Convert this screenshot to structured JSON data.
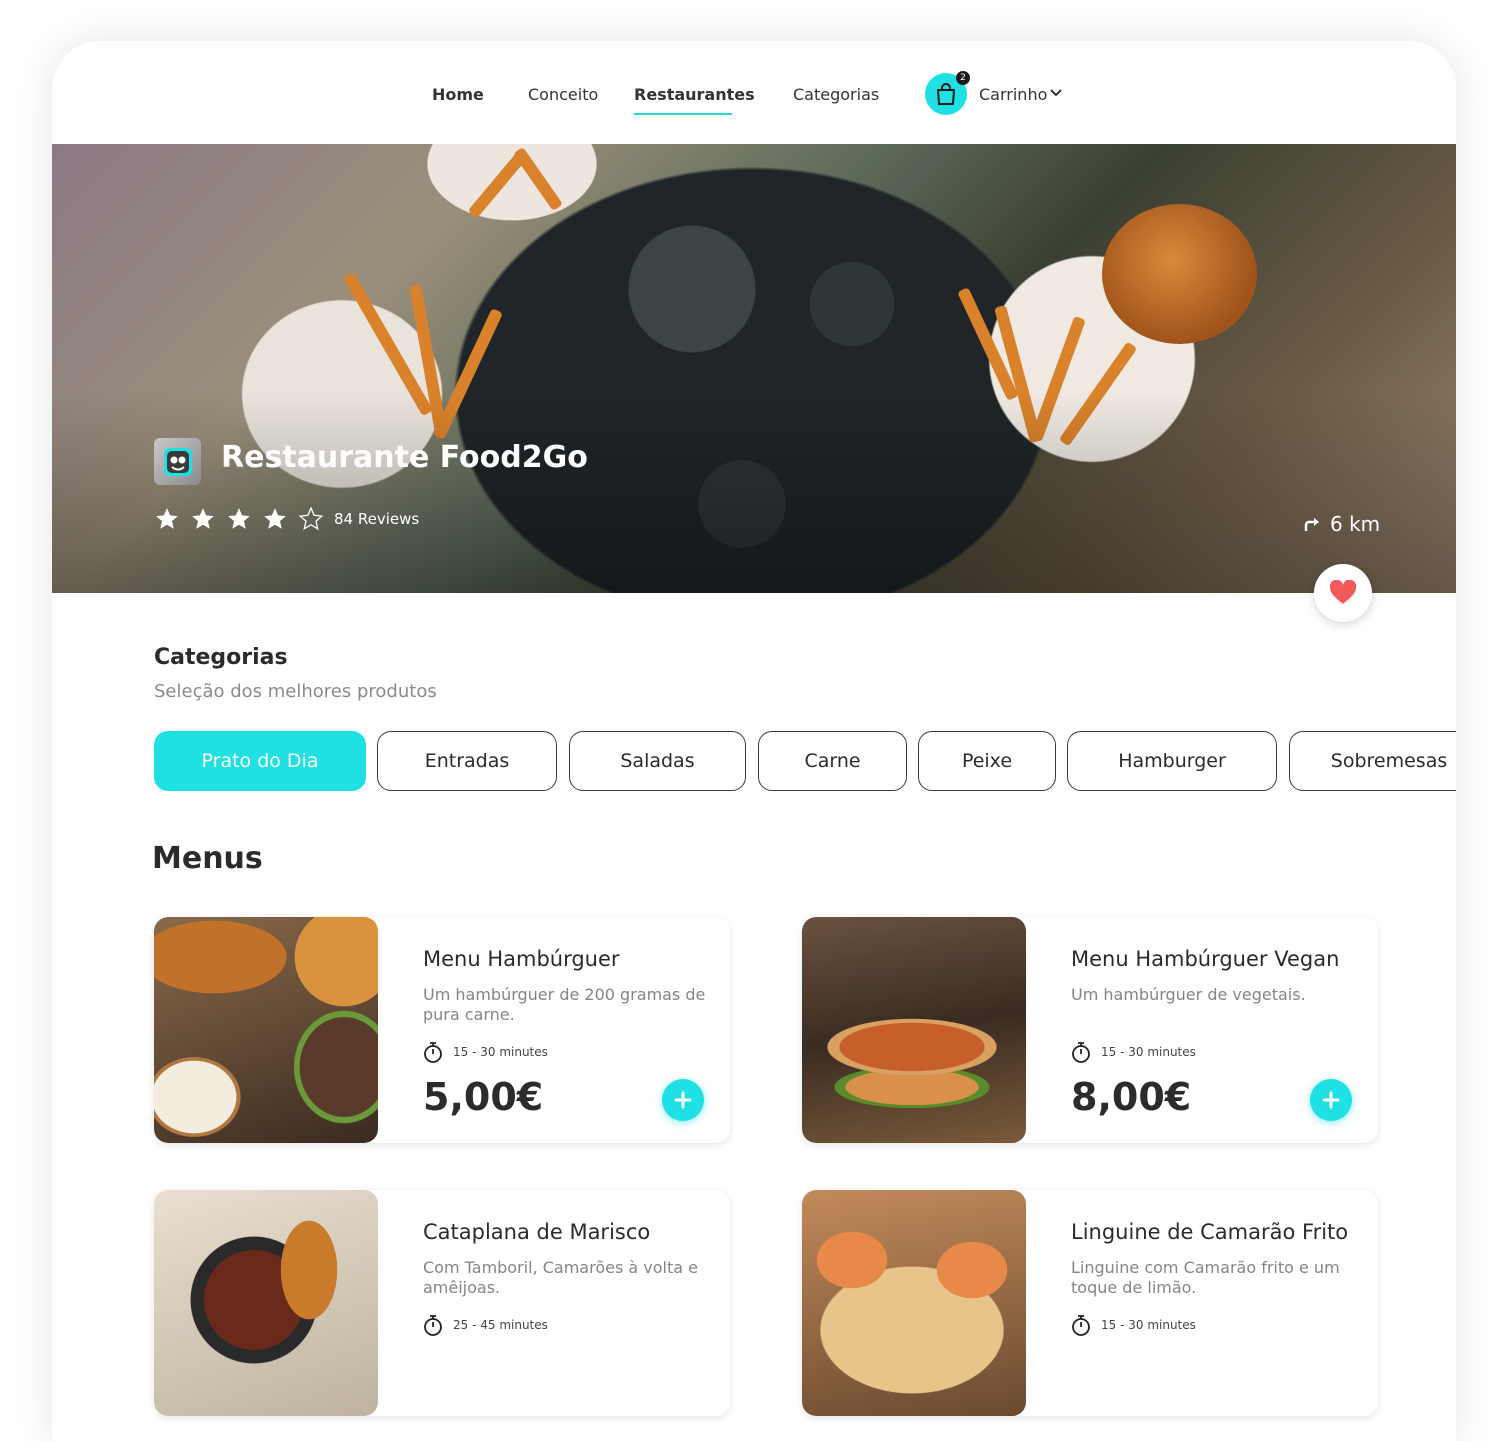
{
  "nav": {
    "items": [
      {
        "label": "Home"
      },
      {
        "label": "Conceito"
      },
      {
        "label": "Restaurantes"
      },
      {
        "label": "Categorias"
      }
    ],
    "active": "Restaurantes",
    "cart": {
      "label": "Carrinho",
      "badge": "2",
      "icon": "shopping-bag-icon"
    }
  },
  "restaurant": {
    "name": "Restaurante Food2Go",
    "rating": 4,
    "rating_max": 5,
    "reviews": "84 Reviews",
    "distance": "6 km",
    "favorite": true
  },
  "categories": {
    "title": "Categorias",
    "subtitle": "Seleção dos melhores produtos",
    "chips": [
      {
        "label": "Prato do Dia",
        "active": true
      },
      {
        "label": "Entradas",
        "active": false
      },
      {
        "label": "Saladas",
        "active": false
      },
      {
        "label": "Carne",
        "active": false
      },
      {
        "label": "Peixe",
        "active": false
      },
      {
        "label": "Hamburger",
        "active": false
      },
      {
        "label": "Sobremesas",
        "active": false
      }
    ]
  },
  "menus": {
    "title": "Menus",
    "items": [
      {
        "name": "Menu Hambúrguer",
        "description": "Um hambúrguer de 200 gramas de pura carne.",
        "time": "15 - 30 minutes",
        "price": "5,00€"
      },
      {
        "name": "Menu Hambúrguer Vegan",
        "description": "Um hambúrguer de vegetais.",
        "time": "15 - 30 minutes",
        "price": "8,00€"
      },
      {
        "name": "Cataplana de Marisco",
        "description": "Com Tamboril, Camarões à volta e amêijoas.",
        "time": "25 - 45 minutes",
        "price": ""
      },
      {
        "name": "Linguine de Camarão Frito",
        "description": "Linguine com Camarão frito e um toque de limão.",
        "time": "15 - 30 minutes",
        "price": ""
      }
    ]
  },
  "colors": {
    "accent": "#1fe0e2",
    "heart": "#f25a5a",
    "text": "#2b2b2b",
    "muted": "#858585"
  }
}
